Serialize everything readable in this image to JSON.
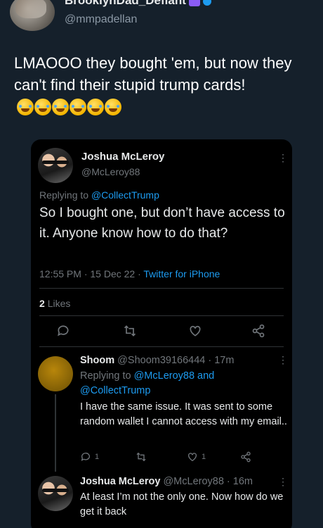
{
  "outer": {
    "name": "BrooklynDad_Defiant",
    "handle": "@mmpadellan",
    "text": "LMAOOO they bought 'em, but now they can't find their stupid trump cards!",
    "emojis": [
      "rofl",
      "rofl",
      "rofl",
      "rofl",
      "rofl",
      "rofl"
    ]
  },
  "main_tweet": {
    "name": "Joshua McLeroy",
    "handle": "@McLeroy88",
    "replying_label": "Replying to",
    "replying_to": "@CollectTrump",
    "text": "So I bought one, but don’t have access to it. Anyone know how to do that?",
    "time": "12:55 PM · 15 Dec 22 · ",
    "source": "Twitter for iPhone",
    "likes_count": "2",
    "likes_label": "Likes"
  },
  "reply1": {
    "name": "Shoom",
    "handle_time": "@Shoom39166444 · 17m",
    "replying_label": "Replying to",
    "replying_to": "@McLeroy88 and @CollectTrump",
    "text": "I have the same issue. It was sent to some random wallet I cannot access with my email..",
    "reply_count": "1",
    "like_count": "1"
  },
  "reply2": {
    "name": "Joshua McLeroy",
    "handle_time": "@McLeroy88 · 16m",
    "text": "At least I’m not the only one. Now how do we get it back"
  },
  "icons": {
    "more": "more-icon",
    "reply": "reply-icon",
    "retweet": "retweet-icon",
    "like": "like-icon",
    "share": "share-icon"
  },
  "colors": {
    "background": "#15202b",
    "card": "#000000",
    "link": "#1d9bf0",
    "muted": "#71767b"
  }
}
